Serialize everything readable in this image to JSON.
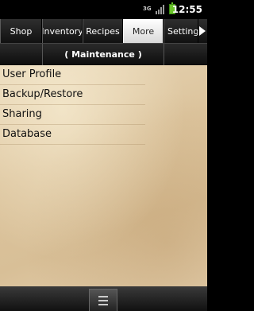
{
  "status_bar": {
    "network": "3G",
    "time": "12:55"
  },
  "tabs": [
    {
      "label": "Shop",
      "active": false
    },
    {
      "label": "Inventory",
      "active": false
    },
    {
      "label": "Recipes",
      "active": false
    },
    {
      "label": "More",
      "active": true
    },
    {
      "label": "Settings",
      "active": false
    }
  ],
  "header": {
    "title": "( Maintenance )"
  },
  "menu_items": [
    {
      "label": "User Profile"
    },
    {
      "label": "Backup/Restore"
    },
    {
      "label": "Sharing"
    },
    {
      "label": "Database"
    }
  ],
  "colors": {
    "active_tab": "#ffffff",
    "battery": "#6bc42b"
  },
  "icons": {
    "tab_scroll": "chevron-right-icon",
    "menu": "menu-icon"
  }
}
